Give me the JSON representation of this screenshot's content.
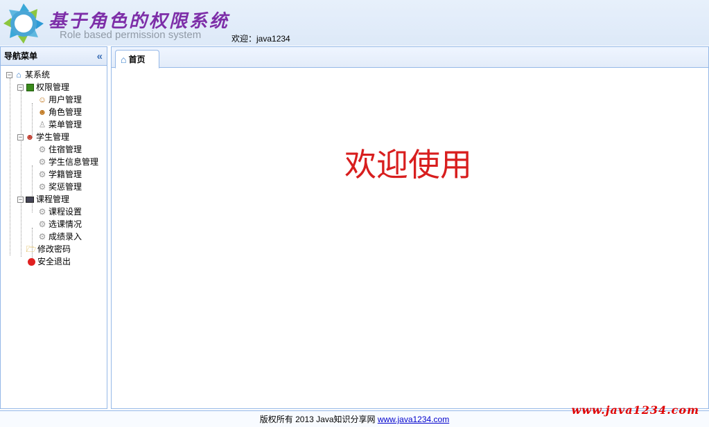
{
  "header": {
    "title": "基于角色的权限系统",
    "subtitle": "Role based permission system",
    "welcome": "欢迎：java1234"
  },
  "west": {
    "title": "导航菜单",
    "collapse_icon": "double-chevron-left-icon"
  },
  "tree": {
    "root": "某系统",
    "groups": [
      {
        "label": "权限管理",
        "icon": "book-icon",
        "items": [
          "用户管理",
          "角色管理",
          "菜单管理"
        ]
      },
      {
        "label": "学生管理",
        "icon": "users-icon",
        "items": [
          "住宿管理",
          "学生信息管理",
          "学籍管理",
          "奖惩管理"
        ]
      },
      {
        "label": "课程管理",
        "icon": "monitor-icon",
        "items": [
          "课程设置",
          "选课情况",
          "成绩录入"
        ]
      }
    ],
    "change_password": "修改密码",
    "logout": "安全退出"
  },
  "tabs": [
    {
      "label": "首页",
      "icon": "home-icon"
    }
  ],
  "main": {
    "welcome_text": "欢迎使用"
  },
  "footer": {
    "copyright": "版权所有 2013 Java知识分享网 ",
    "link": "www.java1234.com"
  },
  "watermark": "www.java1234.com",
  "colors": {
    "accent": "#95b8e7",
    "title": "#7d2ea8",
    "welcome": "#d81e1e"
  }
}
